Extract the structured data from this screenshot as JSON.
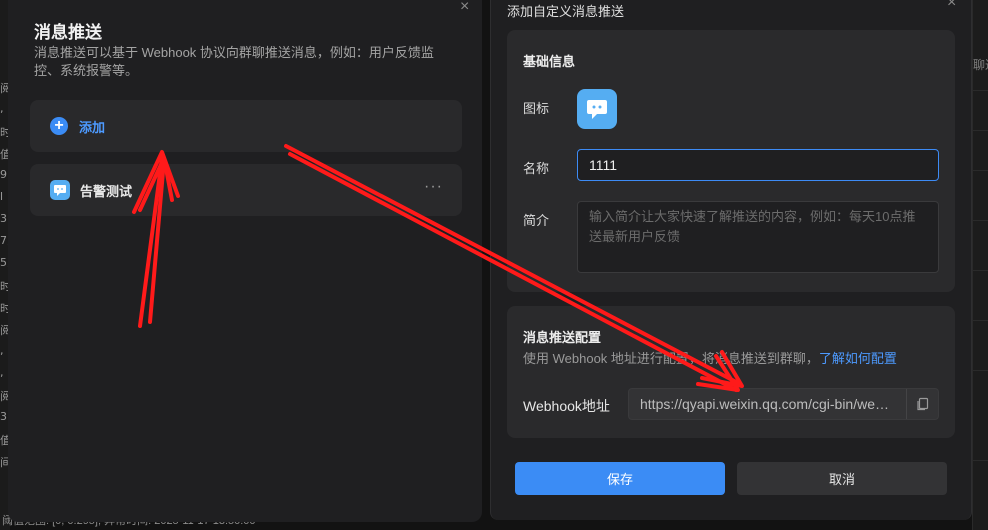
{
  "background": {
    "left_fragments": [
      "阅",
      ",",
      "时",
      "值",
      "9",
      "l",
      "3",
      "7,",
      "5,",
      "时",
      "时",
      "阅",
      ",",
      ",",
      "阅",
      "3",
      "值",
      "间"
    ],
    "right_hint": "聊达",
    "bottom_text": "阈值范围: [0, 0.295]; 异常时间: 2025-11-17 13:50:00"
  },
  "left_panel": {
    "close_glyph": "×",
    "title": "消息推送",
    "description": "消息推送可以基于 Webhook 协议向群聊推送消息，例如：用户反馈监控、系统报警等。",
    "add_label": "添加",
    "items": [
      {
        "label": "告警测试",
        "more": "···"
      }
    ]
  },
  "right_panel": {
    "title": "添加自定义消息推送",
    "close_glyph": "×",
    "basic": {
      "section_title": "基础信息",
      "icon_label": "图标",
      "name_label": "名称",
      "name_value": "1111",
      "intro_label": "简介",
      "intro_placeholder": "输入简介让大家快速了解推送的内容，例如：每天10点推送最新用户反馈"
    },
    "push_config": {
      "section_title": "消息推送配置",
      "description": "使用 Webhook 地址进行配置，将消息推送到群聊，",
      "link_text": "了解如何配置",
      "webhook_label": "Webhook地址",
      "webhook_value": "https://qyapi.weixin.qq.com/cgi-bin/webhook/send"
    },
    "save_label": "保存",
    "cancel_label": "取消"
  },
  "colors": {
    "accent": "#3b8cf5",
    "link": "#4d9aff",
    "icon_bg": "#55adf2",
    "annotation_arrow": "#ff1a1a"
  }
}
